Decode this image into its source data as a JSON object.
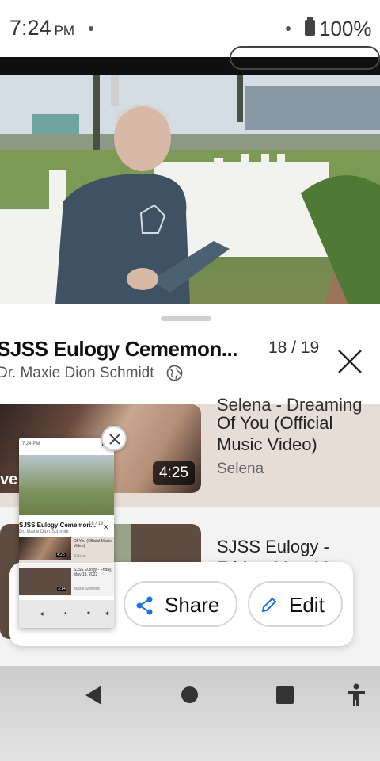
{
  "status_bar": {
    "time": "7:24",
    "ampm": "PM",
    "battery": "100%"
  },
  "now_playing": {
    "title": "SJSS Eulogy Cememon...",
    "position": "18 / 19",
    "channel": "Dr. Maxie Dion Schmidt"
  },
  "playlist": [
    {
      "title_cut": "Selena - Dreaming",
      "title": "Of You (Official Music Video)",
      "channel": "Selena",
      "duration": "4:25",
      "thumb_text": "ve"
    },
    {
      "title": "SJSS Eulogy -",
      "title_cut": "Friday, May 13"
    }
  ],
  "toast": {
    "share_label": "Share",
    "edit_label": "Edit"
  },
  "screenshot_preview": {
    "time": "7:24 PM",
    "battery": "▮ 10",
    "title": "SJSS Eulogy Cememon...",
    "count": "18 / 19",
    "channel": "Dr. Maxie Dion Schmidt",
    "item1_title": "Of You (Official Music Video)",
    "item1_channel": "Selena",
    "item1_duration": "4:25",
    "item2_title": "SJSS Eulogy - Friday, May 13, 2022",
    "item2_channel": "Maxie Schmidt",
    "item2_duration": "3:14"
  },
  "colors": {
    "accent_blue": "#1a73e8",
    "sheet_bg": "#ffffff",
    "playlist_active_bg": "#e6ddd7"
  }
}
